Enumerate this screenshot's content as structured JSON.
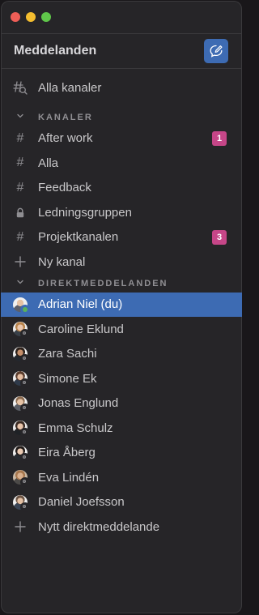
{
  "window": {
    "traffic_lights": [
      "close",
      "minimize",
      "maximize"
    ]
  },
  "header": {
    "title": "Meddelanden",
    "compose_icon": "compose-icon"
  },
  "all_channels": {
    "label": "Alla kanaler",
    "icon": "channel-search-icon"
  },
  "channels": {
    "section_label": "KANALER",
    "items": [
      {
        "label": "After work",
        "icon": "hash",
        "badge": "1"
      },
      {
        "label": "Alla",
        "icon": "hash"
      },
      {
        "label": "Feedback",
        "icon": "hash"
      },
      {
        "label": "Ledningsgruppen",
        "icon": "lock"
      },
      {
        "label": "Projektkanalen",
        "icon": "hash",
        "badge": "3"
      }
    ],
    "add_label": "Ny kanal"
  },
  "direct": {
    "section_label": "DIREKTMEDDELANDEN",
    "items": [
      {
        "label": "Adrian Niel (du)",
        "status": "online",
        "selected": true
      },
      {
        "label": "Caroline Eklund",
        "status": "offline"
      },
      {
        "label": "Zara Sachi",
        "status": "offline"
      },
      {
        "label": "Simone Ek",
        "status": "offline"
      },
      {
        "label": "Jonas Englund",
        "status": "offline"
      },
      {
        "label": "Emma Schulz",
        "status": "offline"
      },
      {
        "label": "Eira Åberg",
        "status": "offline"
      },
      {
        "label": "Eva Lindén",
        "status": "offline"
      },
      {
        "label": "Daniel Joefsson",
        "status": "offline"
      }
    ],
    "add_label": "Nytt direktmeddelande"
  },
  "colors": {
    "accent": "#3d6bb3",
    "badge": "#c64688",
    "online": "#59b15c",
    "background": "#262528"
  }
}
